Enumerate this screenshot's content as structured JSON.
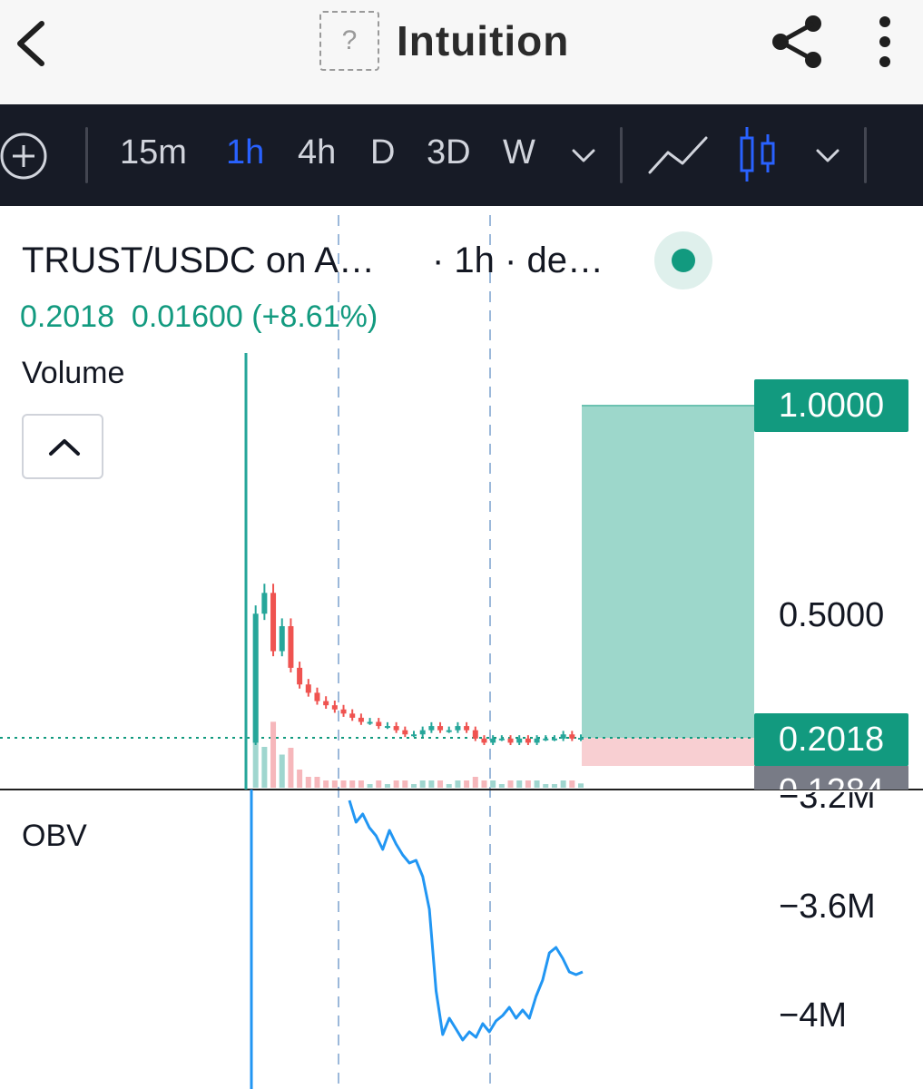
{
  "appbar": {
    "title": "Intuition",
    "logo_placeholder": "?",
    "icons": [
      "back-arrow-icon",
      "share-icon",
      "more-vertical-icon"
    ]
  },
  "toolbar": {
    "timeframes": [
      {
        "label": "15m",
        "active": false
      },
      {
        "label": "1h",
        "active": true
      },
      {
        "label": "4h",
        "active": false
      },
      {
        "label": "D",
        "active": false
      },
      {
        "label": "3D",
        "active": false
      },
      {
        "label": "W",
        "active": false
      }
    ],
    "colors": {
      "background": "#171b26",
      "active": "#2962ff",
      "inactive": "#d1d4dc"
    }
  },
  "chart": {
    "symbol_title": "TRUST/USDC on A…",
    "interval_info": "· 1h · de…",
    "quote": {
      "last": "0.2018",
      "change": "0.01600",
      "change_pct": "(+8.61%)"
    },
    "volume_label": "Volume",
    "obv_label": "OBV",
    "price_axis": [
      "1.0000",
      "0.5000"
    ],
    "price_tags": {
      "current": "0.2018",
      "stop": "0.1284"
    },
    "obv_axis": [
      "−3.2M",
      "−3.6M",
      "−4M"
    ],
    "colors": {
      "up": "#26a69a",
      "down": "#ef5350",
      "obv_line": "#2196f3",
      "target_zone": "#9dd7cb",
      "stop_zone": "#f8cfd2",
      "tag": "#129a7f",
      "stop_tag": "#787b86"
    }
  },
  "chart_data": {
    "type": "line",
    "title": "TRUST/USDC on A… · 1h · de…",
    "price": {
      "last": 0.2018,
      "change": 0.016,
      "change_pct": 8.61,
      "y_ticks": [
        1.0,
        0.5
      ],
      "target_level": 1.0,
      "entry_level": 0.2018,
      "stop_level": 0.1284,
      "series": [
        {
          "name": "close",
          "values": [
            0.19,
            0.5,
            0.55,
            0.41,
            0.47,
            0.37,
            0.33,
            0.31,
            0.29,
            0.28,
            0.27,
            0.26,
            0.25,
            0.24,
            0.24,
            0.23,
            0.23,
            0.22,
            0.21,
            0.21,
            0.22,
            0.23,
            0.22,
            0.22,
            0.23,
            0.22,
            0.2,
            0.19,
            0.2,
            0.2,
            0.19,
            0.2,
            0.19,
            0.2,
            0.2,
            0.2,
            0.21,
            0.2,
            0.2018
          ]
        }
      ]
    },
    "obv": {
      "y_ticks": [
        -3200000,
        -3600000,
        -4000000
      ],
      "series": [
        {
          "name": "OBV",
          "values": [
            -3200000,
            -3280000,
            -3250000,
            -3300000,
            -3330000,
            -3380000,
            -3310000,
            -3360000,
            -3400000,
            -3430000,
            -3420000,
            -3480000,
            -3600000,
            -3900000,
            -4060000,
            -4000000,
            -4040000,
            -4080000,
            -4050000,
            -4070000,
            -4020000,
            -4050000,
            -4010000,
            -3990000,
            -3960000,
            -4000000,
            -3970000,
            -4000000,
            -3920000,
            -3860000,
            -3760000,
            -3740000,
            -3780000,
            -3830000,
            -3840000,
            -3830000
          ]
        }
      ]
    }
  }
}
